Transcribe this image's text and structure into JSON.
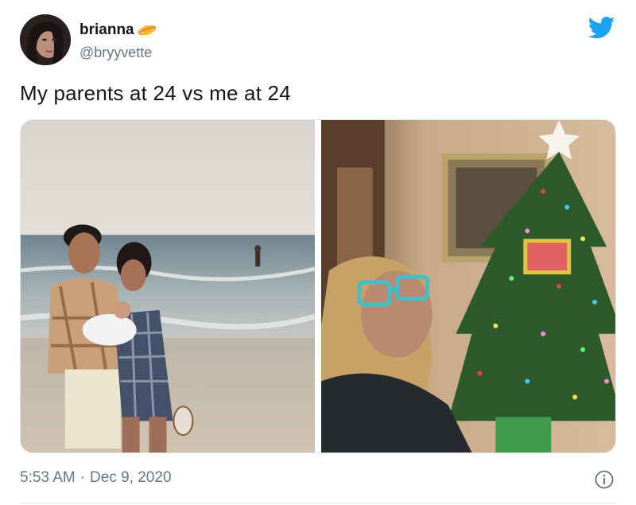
{
  "user": {
    "display_name": "brianna",
    "handle": "@bryyvette",
    "avatar": "avatar-photo",
    "badge_icon": "planet-emoji-icon"
  },
  "tweet": {
    "text": "My parents at 24 vs me at 24",
    "time": "5:53 AM",
    "separator": "·",
    "date": "Dec 9, 2020"
  },
  "media": {
    "left_photo": "parents-on-beach-with-baby",
    "right_photo": "woman-with-glasses-by-christmas-tree"
  },
  "icons": {
    "logo": "twitter-bird-icon",
    "info": "info-icon"
  },
  "colors": {
    "twitter_blue": "#1da1f2",
    "secondary_text": "#657786",
    "primary_text": "#14171a"
  }
}
